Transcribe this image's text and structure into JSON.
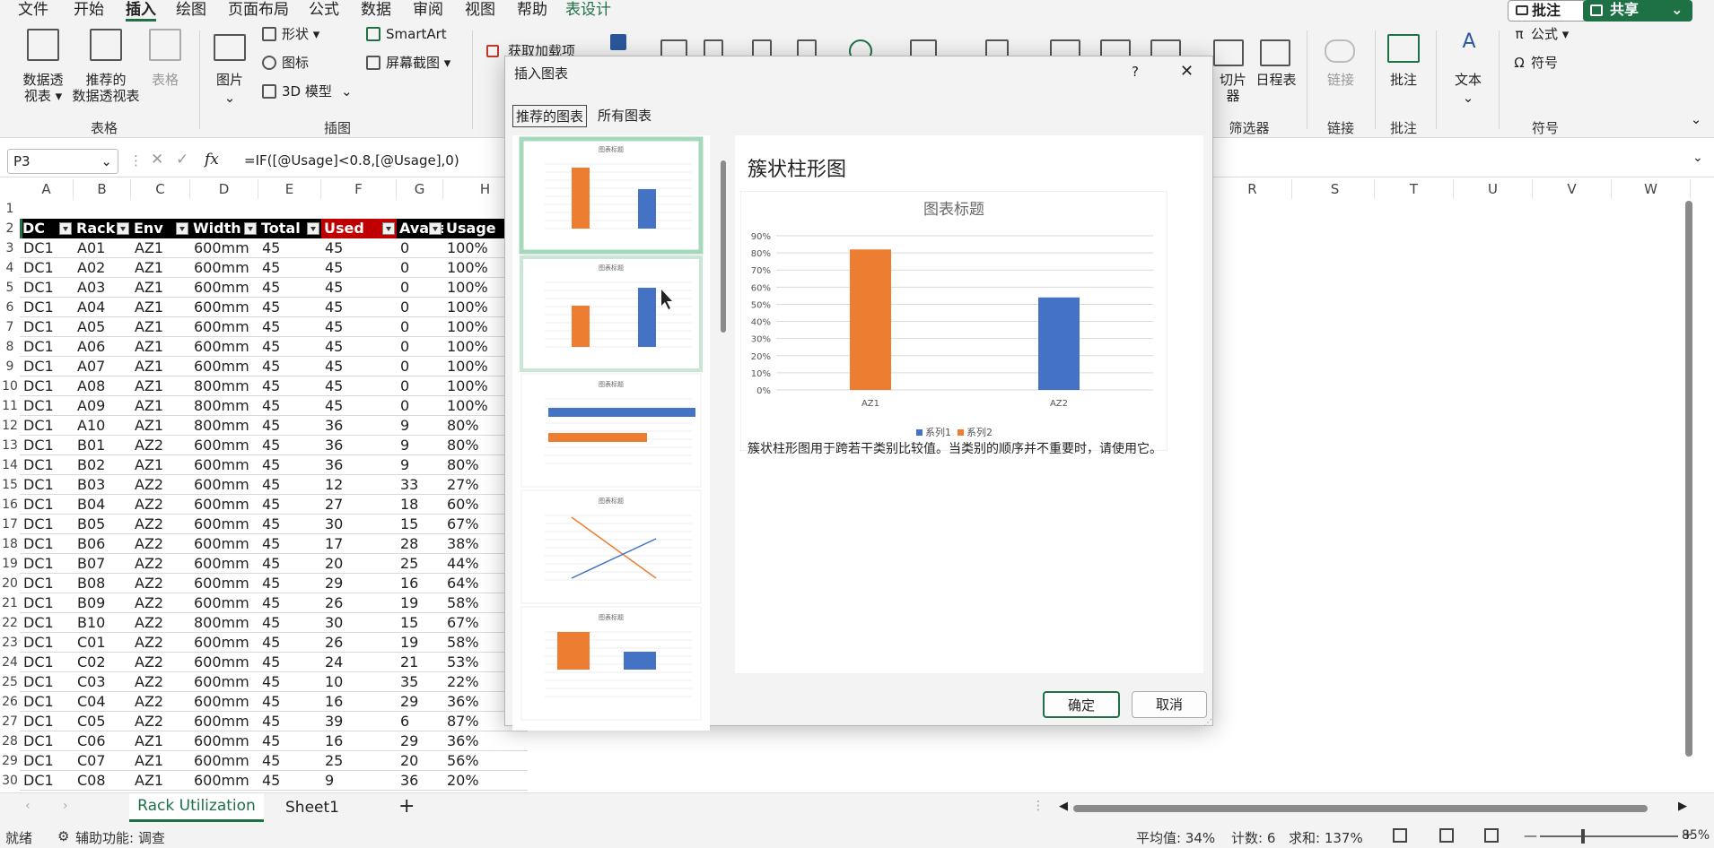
{
  "menu": {
    "items": [
      "文件",
      "开始",
      "插入",
      "绘图",
      "页面布局",
      "公式",
      "数据",
      "审阅",
      "视图",
      "帮助",
      "表设计"
    ],
    "active": "插入",
    "comment": "批注",
    "share": "共享"
  },
  "ribbon": {
    "pivot": "数据透\n视表 ▾",
    "recommended_pivot": "推荐的\n数据透视表",
    "table": "表格",
    "group_tables": "表格",
    "picture": "图片",
    "shapes": "形状 ▾",
    "icons": "图标",
    "model3d": "3D 模型",
    "smartart": "SmartArt",
    "screenshot": "屏幕截图 ▾",
    "group_illustrations": "插图",
    "get_addins": "获取加载项",
    "slicer": "切片器",
    "timeline": "日程表",
    "group_filters": "筛选器",
    "link": "链接",
    "group_links": "链接",
    "comment": "批注",
    "group_comments": "批注",
    "text": "文本",
    "equation": "公式 ▾",
    "symbol": "符号",
    "group_symbols": "符号"
  },
  "formula_bar": {
    "name_box": "P3",
    "formula": "=IF([@Usage]<0.8,[@Usage],0)",
    "fx": "fx"
  },
  "grid": {
    "col_left": [
      "A",
      "B",
      "C",
      "D",
      "E",
      "F",
      "G",
      "H"
    ],
    "col_right": [
      "R",
      "S",
      "T",
      "U",
      "V",
      "W"
    ],
    "headers": [
      "DC",
      "Rack",
      "Env",
      "Width",
      "Total",
      "Used",
      "Availa",
      "Usage"
    ],
    "rows": [
      [
        "DC1",
        "A01",
        "AZ1",
        "600mm",
        "45",
        "45",
        "0",
        "100%"
      ],
      [
        "DC1",
        "A02",
        "AZ1",
        "600mm",
        "45",
        "45",
        "0",
        "100%"
      ],
      [
        "DC1",
        "A03",
        "AZ1",
        "600mm",
        "45",
        "45",
        "0",
        "100%"
      ],
      [
        "DC1",
        "A04",
        "AZ1",
        "600mm",
        "45",
        "45",
        "0",
        "100%"
      ],
      [
        "DC1",
        "A05",
        "AZ1",
        "600mm",
        "45",
        "45",
        "0",
        "100%"
      ],
      [
        "DC1",
        "A06",
        "AZ1",
        "600mm",
        "45",
        "45",
        "0",
        "100%"
      ],
      [
        "DC1",
        "A07",
        "AZ1",
        "600mm",
        "45",
        "45",
        "0",
        "100%"
      ],
      [
        "DC1",
        "A08",
        "AZ1",
        "800mm",
        "45",
        "45",
        "0",
        "100%"
      ],
      [
        "DC1",
        "A09",
        "AZ1",
        "800mm",
        "45",
        "45",
        "0",
        "100%"
      ],
      [
        "DC1",
        "A10",
        "AZ1",
        "800mm",
        "45",
        "36",
        "9",
        "80%"
      ],
      [
        "DC1",
        "B01",
        "AZ2",
        "600mm",
        "45",
        "36",
        "9",
        "80%"
      ],
      [
        "DC1",
        "B02",
        "AZ1",
        "600mm",
        "45",
        "36",
        "9",
        "80%"
      ],
      [
        "DC1",
        "B03",
        "AZ2",
        "600mm",
        "45",
        "12",
        "33",
        "27%"
      ],
      [
        "DC1",
        "B04",
        "AZ2",
        "600mm",
        "45",
        "27",
        "18",
        "60%"
      ],
      [
        "DC1",
        "B05",
        "AZ2",
        "600mm",
        "45",
        "30",
        "15",
        "67%"
      ],
      [
        "DC1",
        "B06",
        "AZ2",
        "600mm",
        "45",
        "17",
        "28",
        "38%"
      ],
      [
        "DC1",
        "B07",
        "AZ2",
        "600mm",
        "45",
        "20",
        "25",
        "44%"
      ],
      [
        "DC1",
        "B08",
        "AZ2",
        "600mm",
        "45",
        "29",
        "16",
        "64%"
      ],
      [
        "DC1",
        "B09",
        "AZ2",
        "600mm",
        "45",
        "26",
        "19",
        "58%"
      ],
      [
        "DC1",
        "B10",
        "AZ2",
        "800mm",
        "45",
        "30",
        "15",
        "67%"
      ],
      [
        "DC1",
        "C01",
        "AZ2",
        "600mm",
        "45",
        "26",
        "19",
        "58%"
      ],
      [
        "DC1",
        "C02",
        "AZ2",
        "600mm",
        "45",
        "24",
        "21",
        "53%"
      ],
      [
        "DC1",
        "C03",
        "AZ2",
        "600mm",
        "45",
        "10",
        "35",
        "22%"
      ],
      [
        "DC1",
        "C04",
        "AZ2",
        "600mm",
        "45",
        "16",
        "29",
        "36%"
      ],
      [
        "DC1",
        "C05",
        "AZ2",
        "600mm",
        "45",
        "39",
        "6",
        "87%"
      ],
      [
        "DC1",
        "C06",
        "AZ1",
        "600mm",
        "45",
        "16",
        "29",
        "36%"
      ],
      [
        "DC1",
        "C07",
        "AZ1",
        "600mm",
        "45",
        "25",
        "20",
        "56%"
      ],
      [
        "DC1",
        "C08",
        "AZ1",
        "600mm",
        "45",
        "9",
        "36",
        "20%"
      ]
    ]
  },
  "sheets": {
    "tabs": [
      "Rack Utilization",
      "Sheet1"
    ],
    "active": "Rack Utilization",
    "add": "+"
  },
  "status": {
    "ready": "就绪",
    "accessibility": "辅助功能: 调查",
    "average": "平均值: 34%",
    "count": "计数: 6",
    "sum": "求和: 137%",
    "zoom": "85%",
    "minus": "—",
    "plus": "+"
  },
  "dialog": {
    "title": "插入图表",
    "help": "?",
    "close": "✕",
    "tabs": [
      "推荐的图表",
      "所有图表"
    ],
    "active_tab": "推荐的图表",
    "thumb_title": "图表标题",
    "chart_name": "簇状柱形图",
    "description": "簇状柱形图用于跨若干类别比较值。当类别的顺序并不重要时，请使用它。",
    "ok": "确定",
    "cancel": "取消"
  },
  "chart_data": {
    "type": "bar",
    "title": "图表标题",
    "categories": [
      "AZ1",
      "AZ2"
    ],
    "series": [
      {
        "name": "系列1",
        "values": [
          null,
          0.54
        ],
        "color": "#4472c4"
      },
      {
        "name": "系列2",
        "values": [
          0.82,
          null
        ],
        "color": "#ed7d31"
      }
    ],
    "ylim": [
      0,
      0.9
    ],
    "yticks": [
      "0%",
      "10%",
      "20%",
      "30%",
      "40%",
      "50%",
      "60%",
      "70%",
      "80%",
      "90%"
    ],
    "grid": true,
    "legend": "bottom"
  }
}
